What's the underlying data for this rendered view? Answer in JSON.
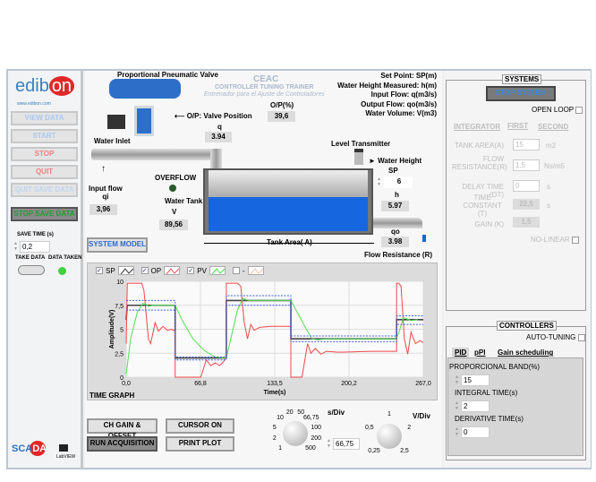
{
  "sidebar": {
    "logo": "edibon",
    "website": "www.edibon.com",
    "buttons": [
      "VIEW DATA",
      "START",
      "STOP",
      "QUIT",
      "QUIT SAVE DATA"
    ],
    "stop_save": "STOP SAVE DATA",
    "save_time_label": "SAVE TIME (s)",
    "save_time": "0,2",
    "take_data": "TAKE DATA",
    "data_taken": "DATA TAKEN",
    "scada": "SCADA",
    "labview": "LabVIEW"
  },
  "process": {
    "valve_title": "Proportional Pneumatic Valve",
    "title": "CEAC",
    "subtitle": "CONTROLLER TUNING TRAINER",
    "subtitle_es": "Entrenador para el Ajuste de Controladores",
    "op_label": "O/P(%)",
    "op_value": "39,6",
    "valve_pos_label": "O/P: Valve Position",
    "q_label": "q",
    "q_value": "3.94",
    "water_inlet": "Water Inlet",
    "input_flow_label": "Input flow",
    "qi_label": "qi",
    "qi_value": "3,96",
    "overflow": "OVERFLOW",
    "water_tank": "Water Tank",
    "v_label": "V",
    "v_value": "89,56",
    "legend": [
      "Set Point: SP(m)",
      "Water Height Measured: h(m)",
      "Input Flow: q(m3/s)",
      "Output Flow: qo(m3/s)",
      "Water Volume: V(m3)"
    ],
    "level_transmitter": "Level Transmitter",
    "water_height": "Water Height",
    "sp_label": "SP",
    "sp_value": "6",
    "h_label": "h",
    "h_value": "5.97",
    "qo_label": "qo",
    "qo_value": "3.98",
    "tank_area": "Tank Area( A)",
    "flow_resistance": "Flow Resistance (R)",
    "system_model": "SYSTEM MODEL"
  },
  "graph": {
    "legend": [
      {
        "label": "SP",
        "checked": true,
        "color": "#333333"
      },
      {
        "label": "OP",
        "checked": true,
        "color": "#f05050"
      },
      {
        "label": "PV",
        "checked": true,
        "color": "#40e040"
      },
      {
        "label": "-",
        "checked": false,
        "color": "#f0c0b0"
      }
    ],
    "title": "TIME GRAPH",
    "chart_data": {
      "type": "line",
      "xlabel": "Time(s)",
      "ylabel": "Amplitude(V)",
      "xlim": [
        0,
        267
      ],
      "ylim": [
        0,
        10
      ],
      "xticks": [
        "0,0",
        "66,8",
        "133,5",
        "200,2",
        "267,0"
      ],
      "yticks": [
        "0",
        "2,5",
        "5",
        "7,5",
        "10"
      ],
      "grid": true,
      "series": [
        {
          "name": "SP",
          "color": "#444444",
          "x": [
            0,
            1,
            44,
            44,
            90,
            90,
            148,
            148,
            243,
            243,
            267
          ],
          "y": [
            6,
            7.5,
            7.5,
            2,
            2,
            8,
            8,
            4,
            4,
            6,
            6
          ]
        },
        {
          "name": "OP",
          "color": "#f04848",
          "x": [
            0,
            1,
            2,
            14,
            16,
            20,
            22,
            26,
            29,
            33,
            37,
            41,
            44,
            44,
            67,
            72,
            76,
            80,
            84,
            88,
            90,
            90,
            100,
            103,
            106,
            109,
            112,
            115,
            120,
            130,
            148,
            148,
            158,
            163,
            166,
            170,
            175,
            180,
            190,
            220,
            243,
            243,
            245,
            247,
            250,
            253,
            256,
            260,
            264,
            267
          ],
          "y": [
            3.5,
            9.8,
            9.8,
            9.8,
            9,
            4,
            3.5,
            5.7,
            4.8,
            5.3,
            4.9,
            5,
            4.8,
            0,
            0,
            1.8,
            1.2,
            1.5,
            1.2,
            1.7,
            2.3,
            9.8,
            9.8,
            9.5,
            5.8,
            4,
            5.5,
            4.9,
            5.2,
            5.3,
            5.3,
            0,
            0,
            3.5,
            2.5,
            3,
            2.4,
            2.7,
            2.6,
            2.7,
            2.7,
            9.8,
            9.8,
            9.5,
            4,
            2.4,
            4.7,
            3.5,
            3.8,
            3.6
          ],
          "dashed": false
        },
        {
          "name": "PV",
          "color": "#50e050",
          "x": [
            0,
            4,
            10,
            15,
            18,
            20,
            24,
            30,
            44,
            50,
            60,
            70,
            80,
            90,
            95,
            100,
            105,
            110,
            115,
            130,
            148,
            155,
            162,
            167,
            172,
            180,
            243,
            246,
            249,
            252,
            256,
            262
          ],
          "y": [
            0.3,
            4,
            6.8,
            7.7,
            7.6,
            7.4,
            7.5,
            7.5,
            7.5,
            6,
            4,
            2.8,
            2.1,
            2,
            4.5,
            7,
            8.2,
            8,
            8,
            8,
            8,
            6.5,
            5,
            4,
            3.9,
            4,
            4,
            5,
            6.2,
            6.1,
            5.9,
            6
          ]
        },
        {
          "name": "SP-band-high",
          "color": "#4060e0",
          "dashed": true,
          "x": [
            0,
            44,
            44,
            90,
            90,
            148,
            148,
            243,
            243,
            267
          ],
          "y": [
            8,
            8,
            2.1,
            2.1,
            8.5,
            8.5,
            4.3,
            4.3,
            6.4,
            6.4
          ]
        },
        {
          "name": "SP-band-low",
          "color": "#4060e0",
          "dashed": true,
          "x": [
            0,
            44,
            44,
            90,
            90,
            148,
            148,
            243,
            243,
            267
          ],
          "y": [
            7,
            7,
            1.8,
            1.8,
            7.5,
            7.5,
            3.7,
            3.7,
            5.5,
            5.5
          ]
        }
      ]
    }
  },
  "bottom": {
    "ch_gain": "CH GAIN & OFFSET",
    "run_acq": "RUN ACQUISITION",
    "cursor_on": "CURSOR ON",
    "print_plot": "PRINT PLOT",
    "s_div_label": "s/Div",
    "s_div_ticks": [
      "1",
      "2",
      "5",
      "10",
      "20",
      "50",
      "66,75",
      "100",
      "200",
      "500"
    ],
    "s_div_value": "66,75",
    "v_div_label": "V/Div",
    "v_div_ticks": [
      "0,25",
      "0,5",
      "1",
      "2",
      "2,5"
    ]
  },
  "systems": {
    "title": "SYSTEMS",
    "stop_system": "STOP SYSTEM",
    "open_loop": "OPEN LOOP",
    "tabs": [
      "INTEGRATOR",
      "FIRST",
      "SECOND"
    ],
    "tank_area_label": "TANK AREA(A)",
    "tank_area": "15",
    "tank_area_unit": "m2",
    "flow_res_label": "FLOW RESISTANCE(R)",
    "flow_res": "1,5",
    "flow_res_unit": "Ns/m5",
    "delay_label": "DELAY TIME (DT)",
    "delay": "0",
    "delay_unit": "s",
    "time_const_label": "TIME CONSTANT (T)",
    "time_const": "22,5",
    "time_const_unit": "s",
    "gain_label": "GAIN (K)",
    "gain": "1,5",
    "no_linear": "NO-LINEAR"
  },
  "controllers": {
    "title": "CONTROLLERS",
    "auto_tuning": "AUTO-TUNING",
    "tabs": [
      "PID",
      "pPI",
      "Gain scheduling"
    ],
    "pb_label": "PROPORCIONAL BAND(%)",
    "pb": "15",
    "ti_label": "INTEGRAL TIME(s)",
    "ti": "2",
    "td_label": "DERIVATIVE TIME(s)",
    "td": "0"
  }
}
